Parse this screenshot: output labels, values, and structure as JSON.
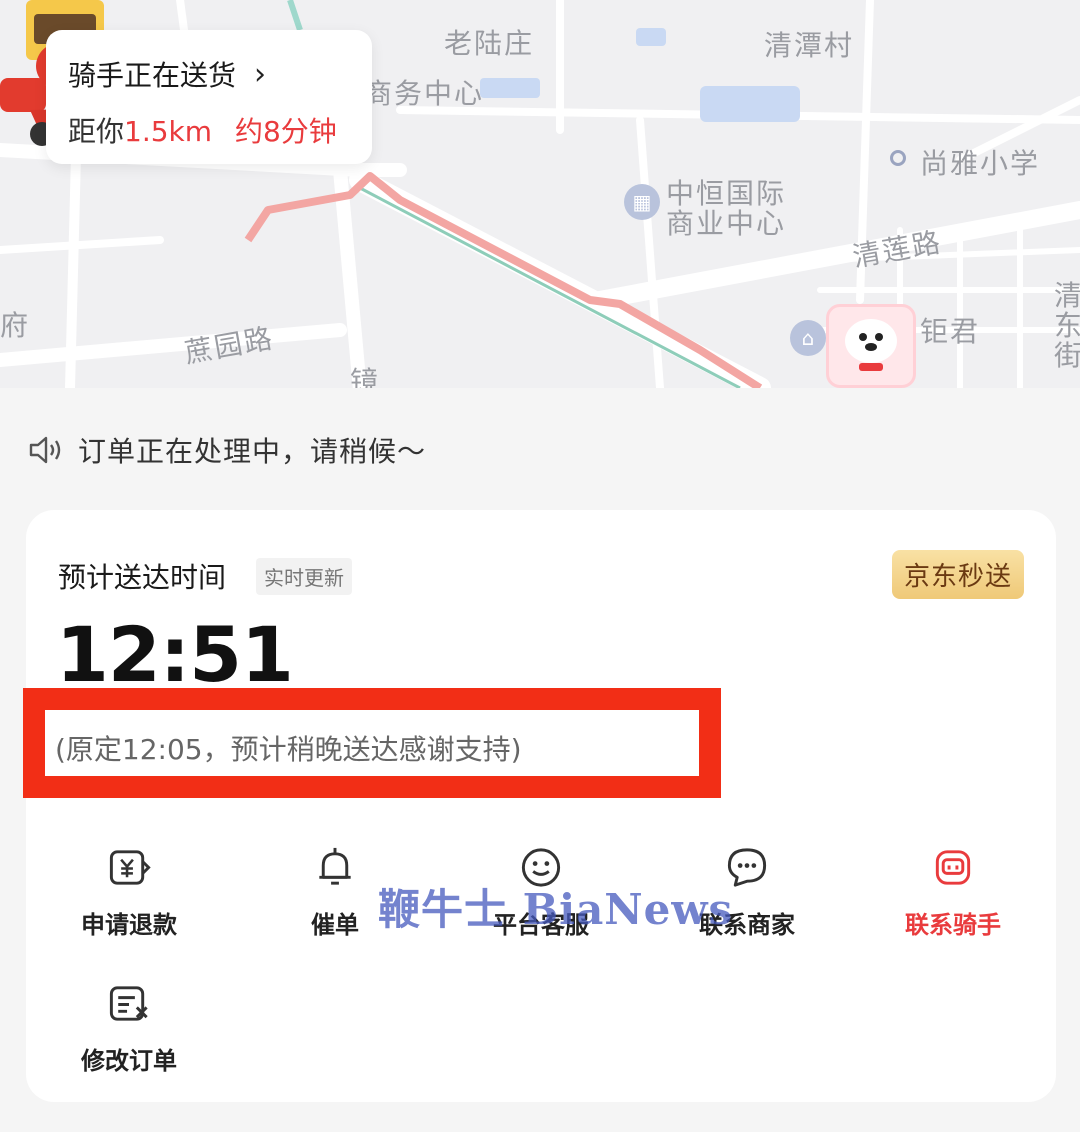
{
  "map": {
    "labels": [
      "老陆庄",
      "清潭村",
      "商务中心",
      "尚雅小学",
      "中恒国际",
      "商业中心",
      "清莲路",
      "蔗园路",
      "钜君",
      "府",
      "镜",
      "清",
      "东",
      "街"
    ]
  },
  "rider_card": {
    "title": "骑手正在送货",
    "distance_prefix": "距你",
    "distance": "1.5km",
    "eta_text": "约8分钟"
  },
  "notice": {
    "text": "订单正在处理中，请稍候～",
    "icon": "speaker-icon"
  },
  "eta": {
    "label": "预计送达时间",
    "tag": "实时更新",
    "badge": "京东秒送",
    "time": "12:51",
    "note": "(原定12:05，预计稍晚送达感谢支持)"
  },
  "actions": [
    {
      "label": "申请退款",
      "icon": "refund-icon"
    },
    {
      "label": "催单",
      "icon": "bell-icon"
    },
    {
      "label": "平台客服",
      "icon": "smile-icon"
    },
    {
      "label": "联系商家",
      "icon": "chat-icon"
    },
    {
      "label": "联系骑手",
      "icon": "rider-icon"
    },
    {
      "label": "修改订单",
      "icon": "edit-order-icon"
    }
  ],
  "watermark": "鞭牛士 BiaNews",
  "colors": {
    "accent_red": "#e93b3d",
    "highlight_border": "#f22e16",
    "badge_gold": "#efc978"
  }
}
